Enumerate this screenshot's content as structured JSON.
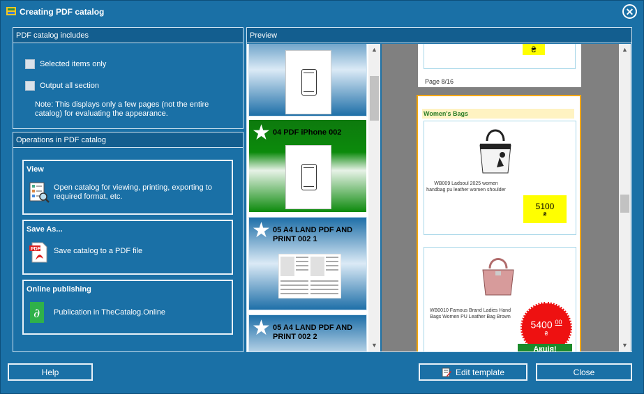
{
  "window": {
    "title": "Creating PDF catalog",
    "close_glyph": "✕"
  },
  "includes": {
    "header": "PDF catalog includes",
    "selected_only": "Selected items only",
    "output_all": "Output all section",
    "note": "Note: This displays only a few pages (not the entire catalog) for evaluating the appearance."
  },
  "operations": {
    "header": "Operations in PDF catalog",
    "view": {
      "title": "View",
      "text": "Open catalog for viewing, printing, exporting to required format, etc.",
      "icon": "catalog-view-icon"
    },
    "save_as": {
      "title": "Save As...",
      "text": "Save catalog to a PDF file",
      "icon": "pdf-file-icon"
    },
    "online": {
      "title": "Online publishing",
      "text": "Publication in TheCatalog.Online",
      "icon": "thecatalog-online-icon"
    }
  },
  "preview": {
    "header": "Preview",
    "templates": [
      {
        "label": ""
      },
      {
        "label": "04 PDF iPhone 002"
      },
      {
        "label": "05 A4 LAND PDF AND PRINT 002 1"
      },
      {
        "label": "05 A4 LAND PDF AND PRINT 002 2"
      }
    ],
    "page_label": "Page 8/16",
    "section_title": "Women's Bags",
    "products": [
      {
        "desc": "WB009 Ladsoul 2025 women handbag pu leather women shoulder",
        "price": "5100",
        "currency": "₴"
      },
      {
        "desc": "WB0010 Famous Brand Ladies Hand Bags Women PU Leather Bag Brown",
        "price": "5400",
        "price_cents": "00",
        "currency": "₴",
        "badge": "Акція!"
      }
    ],
    "top_currency": "₴"
  },
  "buttons": {
    "help": "Help",
    "edit_template": "Edit template",
    "close": "Close"
  },
  "colors": {
    "window_bg": "#1a70a6",
    "active_template": "#0c8a0c",
    "price_yellow": "#ffff00",
    "sale_red": "#ee1111"
  }
}
